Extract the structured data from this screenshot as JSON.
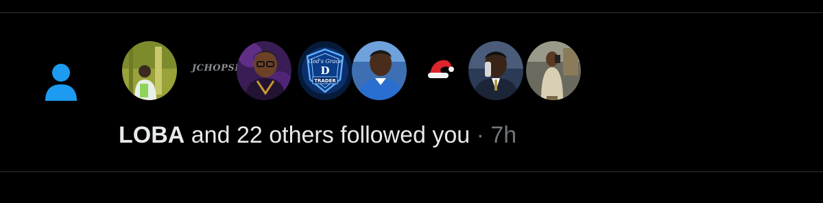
{
  "notification": {
    "type": "follow",
    "actor_name": "LOBA",
    "rest_text": " and 22 others followed you",
    "separator": " · ",
    "time": "7h",
    "icon": "person-icon"
  },
  "avatars": [
    {
      "name": "avatar-1",
      "kind": "photo"
    },
    {
      "name": "avatar-jchopsfx",
      "kind": "logo",
      "text": "JCHOPSFX"
    },
    {
      "name": "avatar-3",
      "kind": "photo"
    },
    {
      "name": "avatar-gods-grace-trader",
      "kind": "logo",
      "text_lines": [
        "God's Grace",
        "D",
        "TRADER"
      ]
    },
    {
      "name": "avatar-5",
      "kind": "photo"
    },
    {
      "name": "avatar-santa-hat",
      "kind": "emoji"
    },
    {
      "name": "avatar-7",
      "kind": "photo"
    },
    {
      "name": "avatar-8",
      "kind": "photo"
    }
  ],
  "colors": {
    "background": "#000000",
    "divider": "#2f3336",
    "accent_icon": "#1d9bf0",
    "primary_text": "#e7e9ea",
    "secondary_text": "#71767b"
  }
}
